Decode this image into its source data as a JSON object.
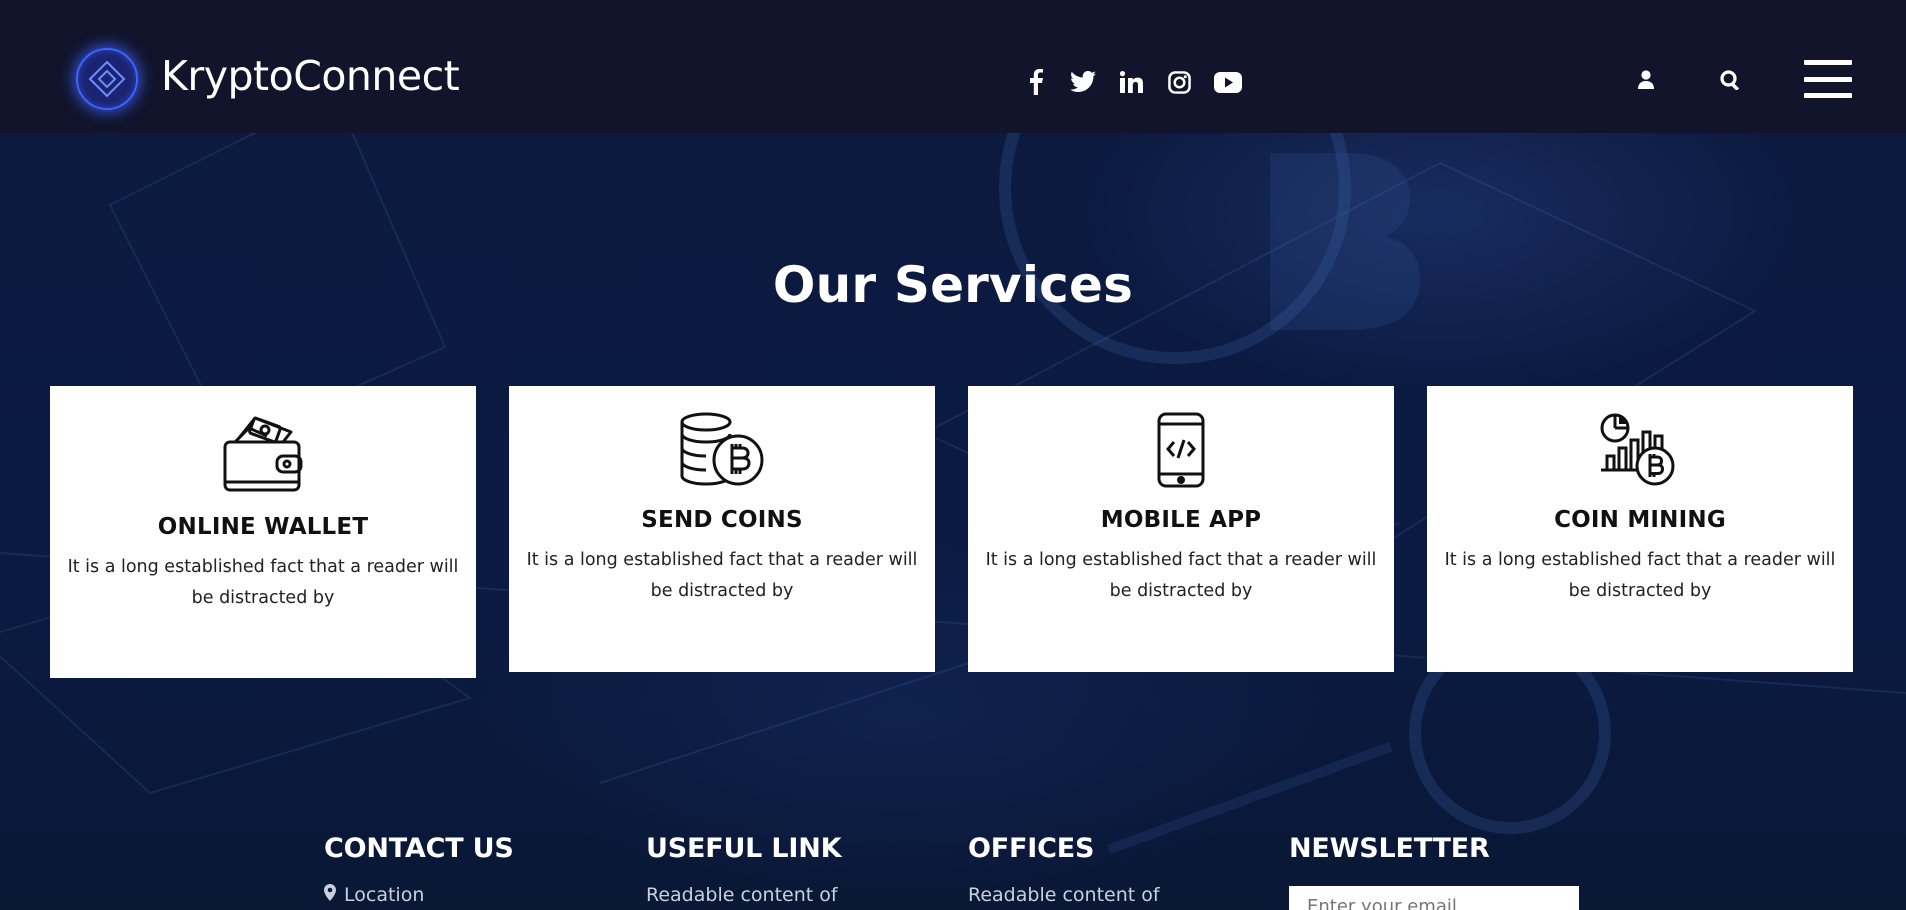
{
  "header": {
    "brand": "KryptoConnect",
    "social": [
      "facebook-icon",
      "twitter-icon",
      "linkedin-icon",
      "instagram-icon",
      "youtube-icon"
    ],
    "icons": [
      "user-icon",
      "search-icon",
      "menu-icon"
    ]
  },
  "services": {
    "title": "Our Services",
    "cards": [
      {
        "title": "ONLINE WALLET",
        "text": "It is a long established fact that a reader will be distracted by",
        "icon": "wallet-icon"
      },
      {
        "title": "SEND COINS",
        "text": "It is a long established fact that a reader will be distracted by",
        "icon": "coins-bitcoin-icon"
      },
      {
        "title": "MOBILE APP",
        "text": "It is a long established fact that a reader will be distracted by",
        "icon": "mobile-code-icon"
      },
      {
        "title": "COIN MINING",
        "text": "It is a long established fact that a reader will be distracted by",
        "icon": "chart-bitcoin-icon"
      }
    ]
  },
  "footer": {
    "contact": {
      "title": "CONTACT US",
      "location": "Location"
    },
    "useful": {
      "title": "USEFUL LINK",
      "text": "Readable content of"
    },
    "offices": {
      "title": "OFFICES",
      "text": "Readable content of"
    },
    "newsletter": {
      "title": "NEWSLETTER",
      "placeholder": "Enter your email"
    }
  },
  "colors": {
    "header_bg": "#11142b",
    "page_bg": "#0b1a42",
    "accent": "#3d63ff",
    "card_bg": "#ffffff"
  }
}
